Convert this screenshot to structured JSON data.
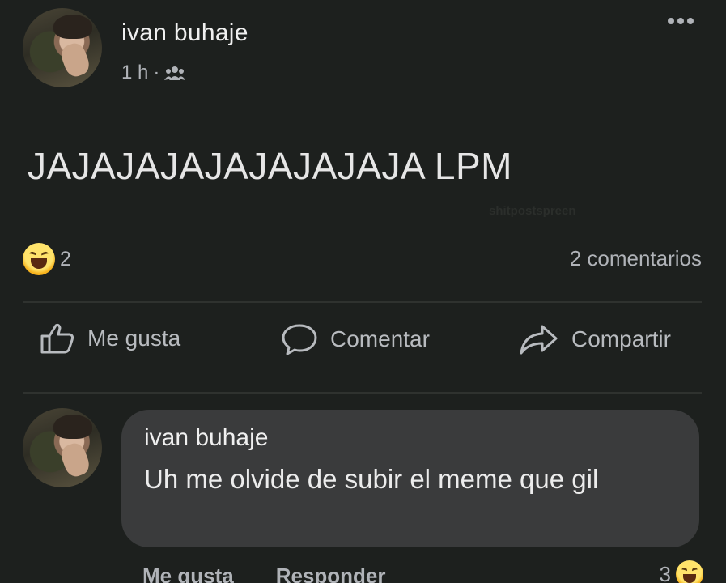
{
  "post": {
    "author": "ivan buhaje",
    "time": "1 h",
    "separator": "·",
    "audience_icon": "friends-icon",
    "text": "JAJAJAJAJAJAJAJAJA LPM",
    "watermark": "shitpostspreen",
    "reactions": {
      "icon": "haha-icon",
      "count": "2"
    },
    "comments_count": "2 comentarios",
    "more_icon": "more-options-icon"
  },
  "actions": {
    "like": "Me gusta",
    "comment": "Comentar",
    "share": "Compartir"
  },
  "comment": {
    "author": "ivan buhaje",
    "text": "Uh me olvide de subir el meme que gil",
    "like": "Me gusta",
    "reply": "Responder",
    "reaction_count": "3",
    "reaction_icon": "haha-icon"
  },
  "colors": {
    "background": "#1d201e",
    "bubble": "#3a3b3c",
    "secondary_text": "#b0b3b8",
    "haha": "#f7b21c"
  }
}
